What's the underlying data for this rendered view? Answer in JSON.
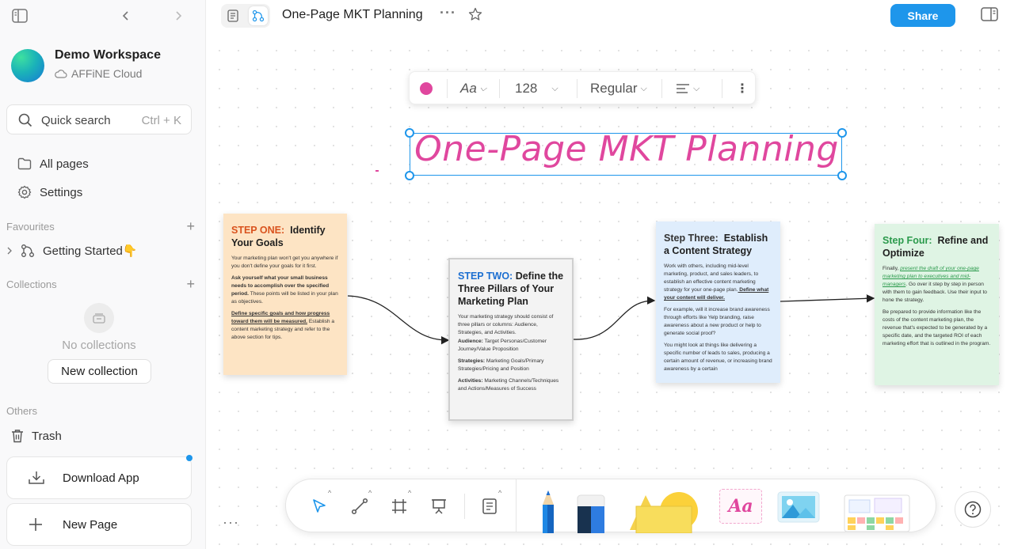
{
  "workspace": {
    "name": "Demo Workspace",
    "cloud": "AFFiNE Cloud"
  },
  "search": {
    "label": "Quick search",
    "shortcut": "Ctrl + K"
  },
  "nav": {
    "all_pages": "All pages",
    "settings": "Settings"
  },
  "favourites": {
    "header": "Favourites",
    "items": [
      {
        "label": "Getting Started👇"
      }
    ]
  },
  "collections": {
    "header": "Collections",
    "empty": "No collections",
    "new_button": "New collection"
  },
  "others": {
    "header": "Others",
    "trash": "Trash"
  },
  "actions": {
    "download": "Download App",
    "new_page": "New Page"
  },
  "header": {
    "title": "One-Page MKT Planning",
    "share": "Share"
  },
  "text_toolbar": {
    "font_glyph": "Aa",
    "size": "128",
    "weight": "Regular",
    "color": "#e0479e"
  },
  "canvas_title": "One-Page MKT Planning",
  "notes": {
    "one": {
      "step": "STEP ONE:",
      "title": "Identify Your Goals",
      "p1": "Your marketing plan won't get you anywhere if you don't define your goals for it first.",
      "p2_bold": "Ask yourself what your small business needs to accomplish over the specified period.",
      "p2_rest": " These points will be listed in your plan as objectives.",
      "p3_u": "Define specific goals and how progress toward them will be measured.",
      "p3_rest": " Establish a content marketing strategy and refer to the above section for tips."
    },
    "two": {
      "step": "STEP TWO:",
      "title": "Define the Three Pillars of Your Marketing Plan",
      "p1": "Your marketing strategy should consist of three pillars or columns: Audience, Strategies, and Activities.",
      "aud_label": "Audience:",
      "aud": " Target Personas/Customer Journey/Value Proposition",
      "str_label": "Strategies:",
      "str": " Marketing Goals/Primary Strategies/Pricing and Position",
      "act_label": "Activities:",
      "act": " Marketing Channels/Techniques and Actions/Measures of Success"
    },
    "three": {
      "step": "Step Three:",
      "title": "Establish a Content Strategy",
      "p1": "Work with others, including mid-level marketing, product, and sales leaders, to establish an effective content marketing strategy for your one-page plan.",
      "p1_u": " Define what your content will deliver.",
      "p2": " For example, will it increase brand awareness through efforts like Yelp branding, raise awareness about a new product or help to generate social proof?",
      "p3": " You might look at things like delivering a specific number of leads to sales, producing a certain amount of revenue, or increasing brand awareness by a certain"
    },
    "four": {
      "step": "Step Four:",
      "title": "Refine and Optimize",
      "p1_a": "Finally, ",
      "p1_link": "present the draft of your one-page marketing plan to executives and mid-managers",
      "p1_b": ". Go over it step by step in person with them to gain feedback. Use their input to hone the strategy.",
      "p2": " Be prepared to provide information like the costs of the content marketing plan, the revenue that's expected to be generated by a specific date, and the targeted ROI of each marketing effort that is outlined in the program."
    }
  },
  "colors": {
    "accent": "#1e96eb",
    "pen": "#e0479e",
    "note1": "#fde4c4",
    "note2": "#f3f3f3",
    "note3": "#dfedfc",
    "note4": "#dff4e4"
  },
  "icons": [
    "sidebar-toggle-icon",
    "back-icon",
    "forward-icon",
    "cloud-icon",
    "search-icon",
    "folder-icon",
    "gear-icon",
    "edgeless-icon",
    "trash-icon",
    "download-icon",
    "plus-icon",
    "star-icon",
    "more-icon",
    "pointer-icon",
    "connector-icon",
    "frame-icon",
    "presentation-icon",
    "note-icon",
    "pen-icon",
    "eraser-icon",
    "shape-icon",
    "text-icon",
    "image-icon",
    "template-icon",
    "help-icon"
  ]
}
